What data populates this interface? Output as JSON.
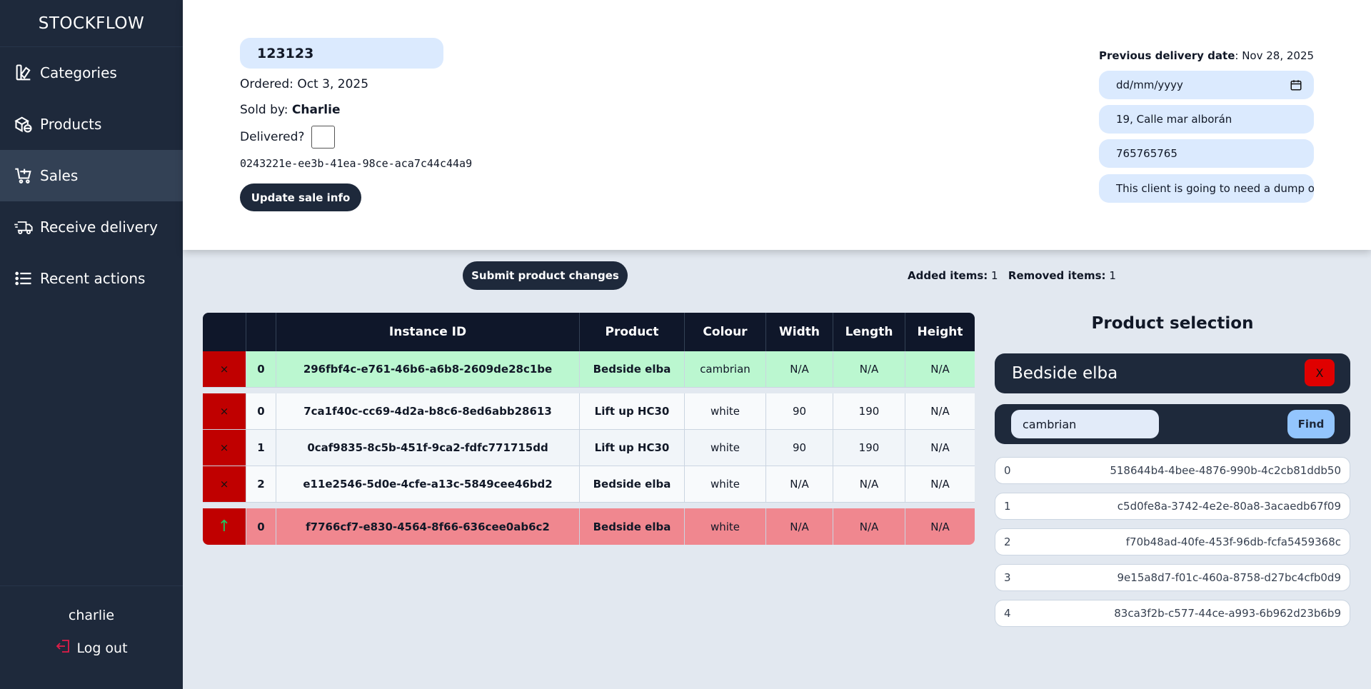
{
  "sidebar": {
    "brand": "STOCKFLOW",
    "items": [
      {
        "label": "Categories",
        "icon": "categories-icon"
      },
      {
        "label": "Products",
        "icon": "products-icon"
      },
      {
        "label": "Sales",
        "icon": "cart-icon",
        "active": true
      },
      {
        "label": "Receive delivery",
        "icon": "truck-icon"
      },
      {
        "label": "Recent actions",
        "icon": "list-icon"
      }
    ],
    "username": "charlie",
    "logout_label": "Log out"
  },
  "sale": {
    "id": "123123",
    "ordered_label": "Ordered:",
    "ordered_date": "Oct 3, 2025",
    "sold_by_label": "Sold by:",
    "sold_by": "Charlie",
    "delivered_label": "Delivered?",
    "delivered": false,
    "uuid": "0243221e-ee3b-41ea-98ce-aca7c44c44a9",
    "update_button": "Update sale info"
  },
  "delivery": {
    "previous_label": "Previous delivery date",
    "previous_date": "Nov 28, 2025",
    "date_placeholder": "dd/mm/yyyy",
    "address": "19, Calle mar alborán",
    "phone": "765765765",
    "notes": "This client is going to need a dump of the old bed"
  },
  "changes": {
    "submit_button": "Submit product changes",
    "added_label": "Added items:",
    "added_count": "1",
    "removed_label": "Removed items:",
    "removed_count": "1"
  },
  "table": {
    "headers": [
      "",
      "",
      "Instance ID",
      "Product",
      "Colour",
      "Width",
      "Length",
      "Height"
    ],
    "added_rows": [
      {
        "action": "×",
        "idx": "0",
        "id": "296fbf4c-e761-46b6-a6b8-2609de28c1be",
        "product": "Bedside elba",
        "colour": "cambrian",
        "width": "N/A",
        "length": "N/A",
        "height": "N/A"
      }
    ],
    "rows": [
      {
        "action": "×",
        "idx": "0",
        "id": "7ca1f40c-cc69-4d2a-b8c6-8ed6abb28613",
        "product": "Lift up HC30",
        "colour": "white",
        "width": "90",
        "length": "190",
        "height": "N/A"
      },
      {
        "action": "×",
        "idx": "1",
        "id": "0caf9835-8c5b-451f-9ca2-fdfc771715dd",
        "product": "Lift up HC30",
        "colour": "white",
        "width": "90",
        "length": "190",
        "height": "N/A"
      },
      {
        "action": "×",
        "idx": "2",
        "id": "e11e2546-5d0e-4cfe-a13c-5849cee46bd2",
        "product": "Bedside elba",
        "colour": "white",
        "width": "N/A",
        "length": "N/A",
        "height": "N/A"
      }
    ],
    "removed_rows": [
      {
        "action": "↑",
        "idx": "0",
        "id": "f7766cf7-e830-4564-8f66-636cee0ab6c2",
        "product": "Bedside elba",
        "colour": "white",
        "width": "N/A",
        "length": "N/A",
        "height": "N/A"
      }
    ]
  },
  "product_selection": {
    "title": "Product selection",
    "selected_product": "Bedside elba",
    "clear_label": "X",
    "search_value": "cambrian",
    "find_label": "Find",
    "results": [
      {
        "idx": "0",
        "id": "518644b4-4bee-4876-990b-4c2cb81ddb50"
      },
      {
        "idx": "1",
        "id": "c5d0fe8a-3742-4e2e-80a8-3acaedb67f09"
      },
      {
        "idx": "2",
        "id": "f70b48ad-40fe-453f-96db-fcfa5459368c"
      },
      {
        "idx": "3",
        "id": "9e15a8d7-f01c-460a-8758-d27bc4cfb0d9"
      },
      {
        "idx": "4",
        "id": "83ca3f2b-c577-44ce-a993-6b962d23b6b9"
      }
    ]
  },
  "colors": {
    "sidebar": "#1e293b",
    "added_row": "#bbf7d0",
    "removed_row": "#f0878f",
    "action_red": "#c00000",
    "field_blue": "#dbeafe"
  }
}
